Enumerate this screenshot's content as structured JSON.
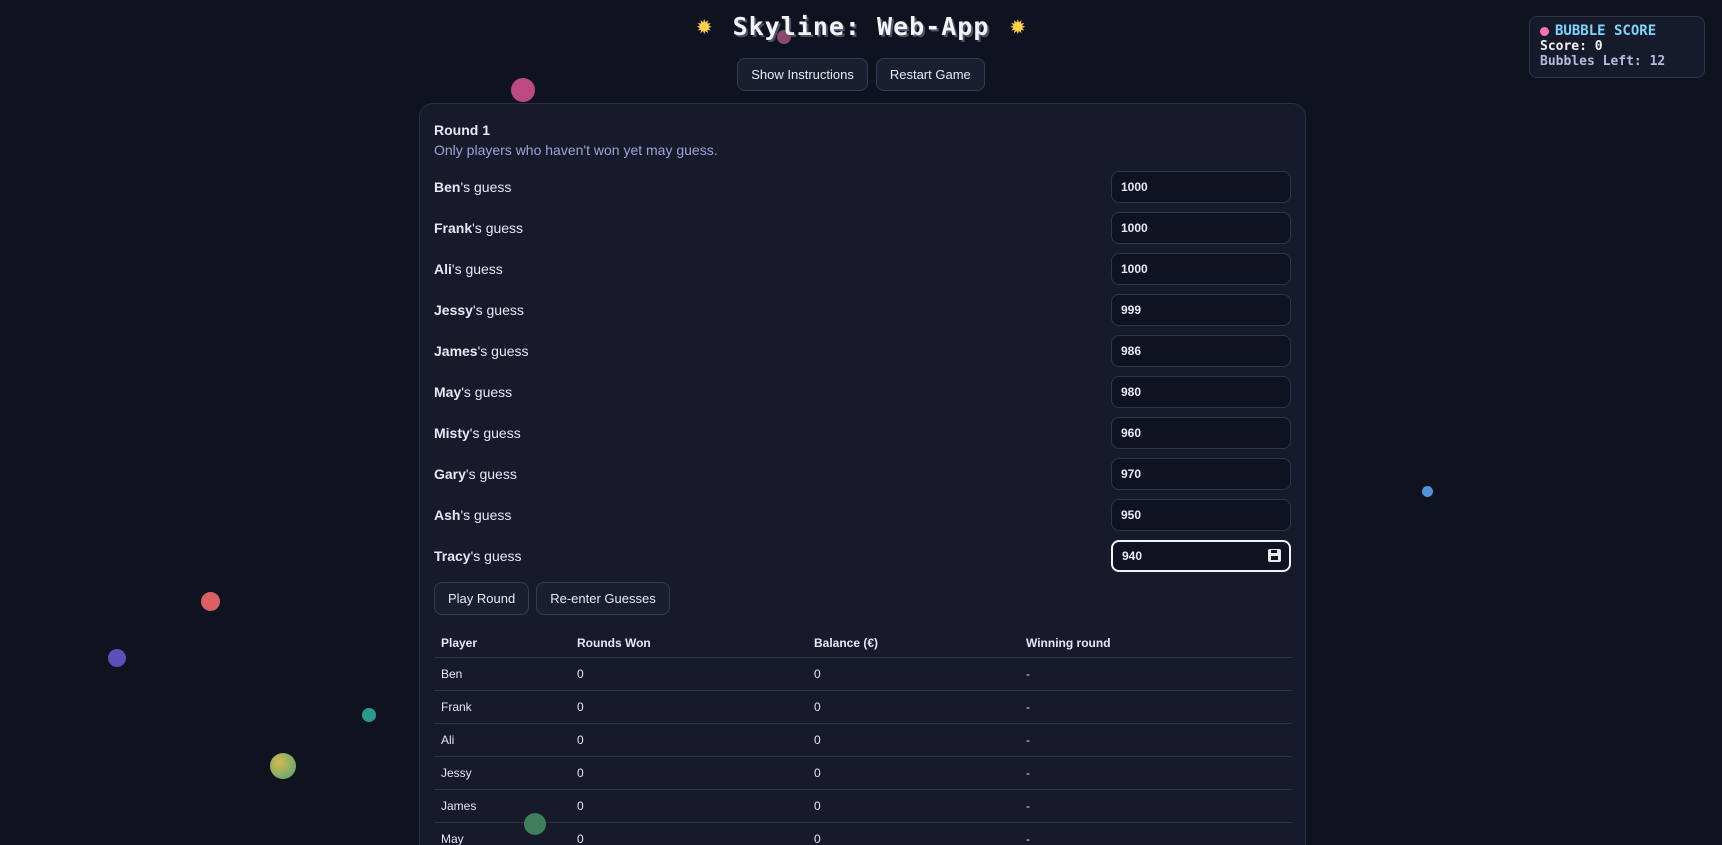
{
  "header": {
    "title": "Skyline: Web-App",
    "icon_left": "sun-icon",
    "icon_right": "sun-icon",
    "show_instructions": "Show Instructions",
    "restart_game": "Restart Game"
  },
  "score_panel": {
    "heading": "BUBBLE SCORE",
    "score_label": "Score: 0",
    "bubbles_left_label": "Bubbles Left: 12",
    "icon": "bubble-icon"
  },
  "round": {
    "title": "Round 1",
    "subtitle": "Only players who haven't won yet may guess.",
    "guess_suffix": "'s guess",
    "guesses": [
      {
        "name": "Ben",
        "value": "1000"
      },
      {
        "name": "Frank",
        "value": "1000"
      },
      {
        "name": "Ali",
        "value": "1000"
      },
      {
        "name": "Jessy",
        "value": "999"
      },
      {
        "name": "James",
        "value": "986"
      },
      {
        "name": "May",
        "value": "980"
      },
      {
        "name": "Misty",
        "value": "960"
      },
      {
        "name": "Gary",
        "value": "970"
      },
      {
        "name": "Ash",
        "value": "950"
      },
      {
        "name": "Tracy",
        "value": "940"
      }
    ],
    "play_round": "Play Round",
    "reenter_guesses": "Re-enter Guesses"
  },
  "table": {
    "headers": [
      "Player",
      "Rounds Won",
      "Balance (€)",
      "Winning round"
    ],
    "rows": [
      [
        "Ben",
        "0",
        "0",
        "-"
      ],
      [
        "Frank",
        "0",
        "0",
        "-"
      ],
      [
        "Ali",
        "0",
        "0",
        "-"
      ],
      [
        "Jessy",
        "0",
        "0",
        "-"
      ],
      [
        "James",
        "0",
        "0",
        "-"
      ],
      [
        "May",
        "0",
        "0",
        "-"
      ]
    ]
  },
  "colors": {
    "background": "#0f1320",
    "card": "#161a2a",
    "accent_blue": "#7fd4ff",
    "sun": "#ffd24a"
  }
}
